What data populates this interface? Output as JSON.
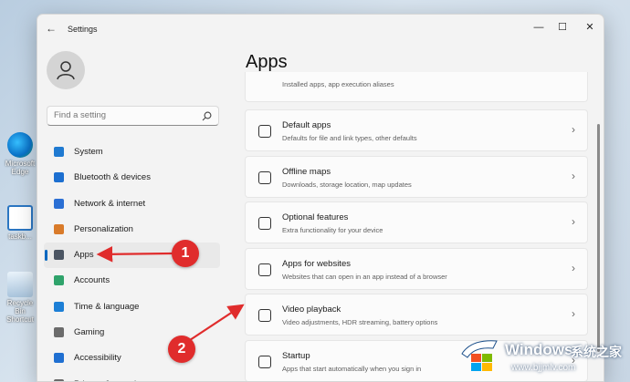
{
  "desktop": {
    "icons": [
      {
        "label": "Microsoft Edge",
        "icon": "edge-icon"
      },
      {
        "label": "taskb...",
        "icon": "shortcut-icon"
      },
      {
        "label": "Recycle Bin Shortcut",
        "icon": "recycle-bin-icon"
      }
    ]
  },
  "window": {
    "title": "Settings",
    "back_glyph": "←",
    "controls": {
      "minimize": "—",
      "maximize": "☐",
      "close": "✕"
    }
  },
  "search": {
    "placeholder": "Find a setting",
    "value": ""
  },
  "sidebar": {
    "items": [
      {
        "label": "System",
        "icon": "monitor-icon",
        "color": "#1f7ad1",
        "active": false
      },
      {
        "label": "Bluetooth & devices",
        "icon": "bluetooth-icon",
        "color": "#1c6fd0",
        "active": false
      },
      {
        "label": "Network & internet",
        "icon": "wifi-icon",
        "color": "#2b6fd4",
        "active": false
      },
      {
        "label": "Personalization",
        "icon": "brush-icon",
        "color": "#d97b2a",
        "active": false
      },
      {
        "label": "Apps",
        "icon": "apps-icon",
        "color": "#4b5563",
        "active": true
      },
      {
        "label": "Accounts",
        "icon": "person-icon",
        "color": "#2fa36b",
        "active": false
      },
      {
        "label": "Time & language",
        "icon": "globe-clock-icon",
        "color": "#1c7fd6",
        "active": false
      },
      {
        "label": "Gaming",
        "icon": "controller-icon",
        "color": "#6b6b6b",
        "active": false
      },
      {
        "label": "Accessibility",
        "icon": "accessibility-icon",
        "color": "#1f6fd1",
        "active": false
      },
      {
        "label": "Privacy & security",
        "icon": "shield-icon",
        "color": "#6b6b6b",
        "active": false
      }
    ]
  },
  "main": {
    "title": "Apps",
    "partial_card": {
      "description": "Installed apps, app execution aliases"
    },
    "cards": [
      {
        "title": "Default apps",
        "description": "Defaults for file and link types, other defaults",
        "icon": "default-apps-icon"
      },
      {
        "title": "Offline maps",
        "description": "Downloads, storage location, map updates",
        "icon": "map-icon"
      },
      {
        "title": "Optional features",
        "description": "Extra functionality for your device",
        "icon": "optional-features-icon"
      },
      {
        "title": "Apps for websites",
        "description": "Websites that can open in an app instead of a browser",
        "icon": "apps-websites-icon"
      },
      {
        "title": "Video playback",
        "description": "Video adjustments, HDR streaming, battery options",
        "icon": "video-icon"
      },
      {
        "title": "Startup",
        "description": "Apps that start automatically when you sign in",
        "icon": "startup-icon"
      }
    ],
    "chevron": "›"
  },
  "annotations": {
    "step1": "1",
    "step2": "2",
    "arrow_color": "#e02c2c"
  },
  "watermark": {
    "brand": "Windows",
    "cn": "系统之家",
    "url": "www.bjjmlv.com"
  }
}
